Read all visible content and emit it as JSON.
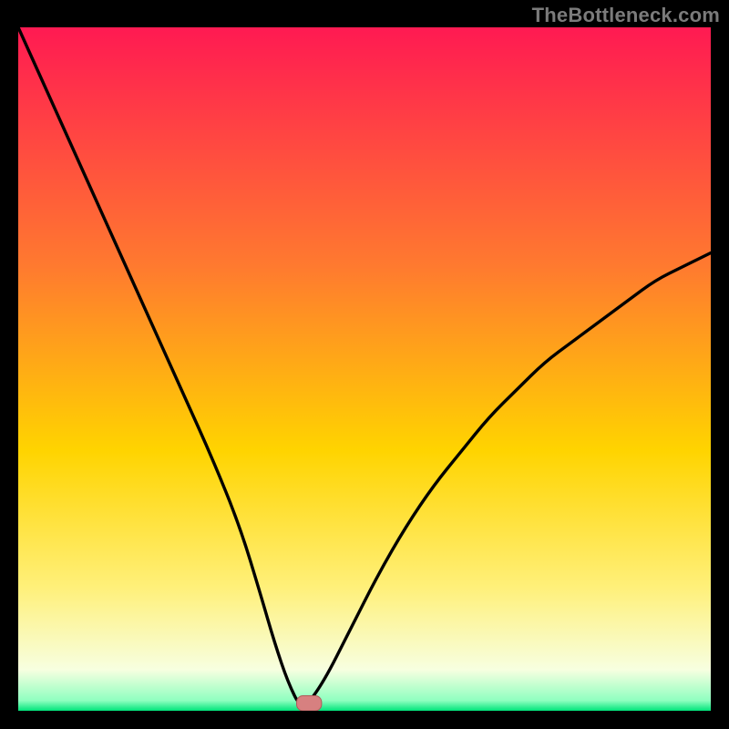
{
  "watermark": {
    "text": "TheBottleneck.com"
  },
  "colors": {
    "gradient_top": "#ff1a52",
    "gradient_mid_upper": "#ff7a2f",
    "gradient_mid": "#ffd400",
    "gradient_mid_lower": "#fff07a",
    "gradient_green": "#00e47a",
    "curve": "#000000",
    "marker_fill": "#d78080",
    "marker_stroke": "#b05a5a",
    "frame": "#000000"
  },
  "chart_data": {
    "type": "line",
    "title": "",
    "xlabel": "",
    "ylabel": "",
    "xlim": [
      0,
      100
    ],
    "ylim": [
      0,
      100
    ],
    "series": [
      {
        "name": "bottleneck-curve",
        "x": [
          0,
          4,
          8,
          12,
          16,
          20,
          24,
          28,
          32,
          35,
          37,
          39,
          41,
          44,
          48,
          52,
          56,
          60,
          64,
          68,
          72,
          76,
          80,
          84,
          88,
          92,
          96,
          100
        ],
        "y": [
          100,
          91,
          82,
          73,
          64,
          55,
          46,
          37,
          27,
          17,
          10,
          4,
          0,
          4,
          12,
          20,
          27,
          33,
          38,
          43,
          47,
          51,
          54,
          57,
          60,
          63,
          65,
          67
        ]
      }
    ],
    "marker": {
      "x": 42,
      "y": 0,
      "width": 3.6,
      "height": 2.2
    },
    "gradient_stops": [
      {
        "offset": 0,
        "color": "#ff1a52"
      },
      {
        "offset": 0.35,
        "color": "#ff7a2f"
      },
      {
        "offset": 0.62,
        "color": "#ffd400"
      },
      {
        "offset": 0.82,
        "color": "#fff07a"
      },
      {
        "offset": 0.94,
        "color": "#f7ffe0"
      },
      {
        "offset": 0.985,
        "color": "#8fffc0"
      },
      {
        "offset": 1.0,
        "color": "#00e47a"
      }
    ]
  }
}
